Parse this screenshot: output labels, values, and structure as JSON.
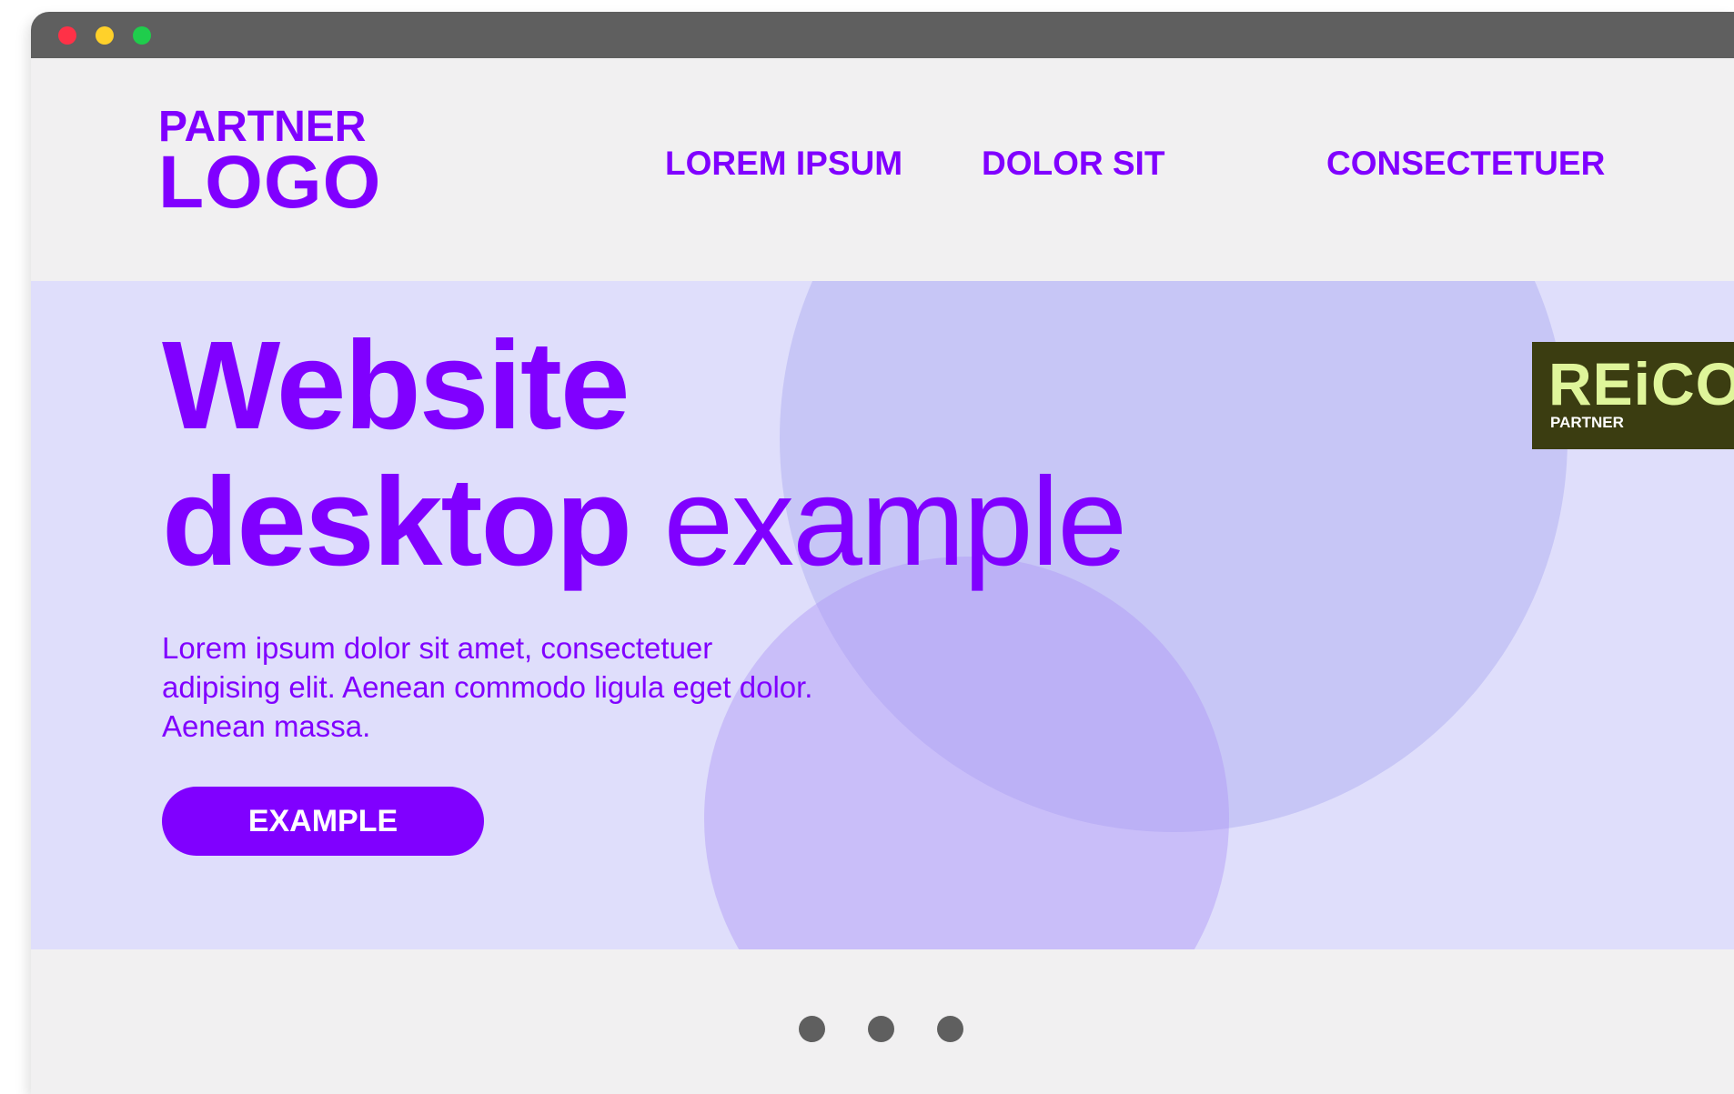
{
  "colors": {
    "accent": "#8000ff",
    "window_bg": "#f1f0f1",
    "titlebar": "#5f5f5f",
    "hero_bg": "#dfdefb",
    "dot_close": "#ff3147",
    "dot_minimize": "#ffd12a",
    "dot_maximize": "#1fcd4c",
    "badge_bg": "#3b3d11",
    "badge_text": "#dff59a"
  },
  "header": {
    "logo": {
      "line1": "PARTNER",
      "line2": "LOGO"
    },
    "nav": [
      {
        "label": "LOREM IPSUM"
      },
      {
        "label": "DOLOR SIT"
      },
      {
        "label": "CONSECTETUER"
      }
    ]
  },
  "hero": {
    "title_bold_1": "Website",
    "title_bold_2": "desktop",
    "title_regular": "example",
    "body": "Lorem ipsum dolor sit amet, consectetuer adipising elit. Aenean commodo ligula eget dolor. Aenean massa.",
    "button_label": "EXAMPLE",
    "badge": {
      "brand": "REiCO",
      "sub": "PARTNER"
    }
  },
  "pager": {
    "count": 3
  }
}
